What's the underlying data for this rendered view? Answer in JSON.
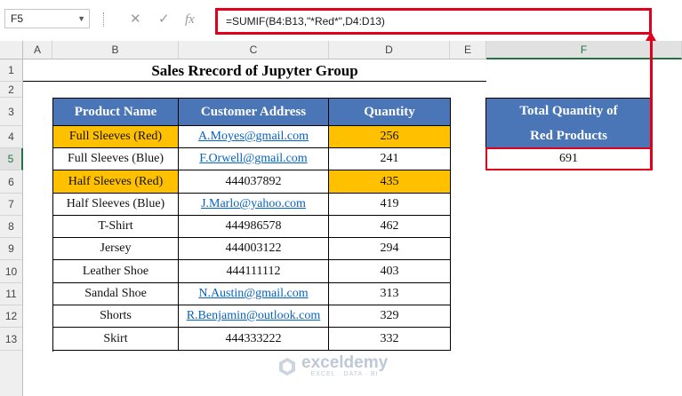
{
  "formula_bar": {
    "name_box": "F5",
    "formula": "=SUMIF(B4:B13,\"*Red*\",D4:D13)"
  },
  "columns": [
    "A",
    "B",
    "C",
    "D",
    "E",
    "F"
  ],
  "rows": [
    "1",
    "2",
    "3",
    "4",
    "5",
    "6",
    "7",
    "8",
    "9",
    "10",
    "11",
    "12",
    "13"
  ],
  "title": "Sales Rrecord of Jupyter Group",
  "table": {
    "headers": [
      "Product Name",
      "Customer Address",
      "Quantity"
    ],
    "rows": [
      {
        "product": "Full Sleeves (Red)",
        "address": "A.Moyes@gmail.com",
        "qty": "256"
      },
      {
        "product": "Full Sleeves (Blue)",
        "address": "F.Orwell@gmail.com",
        "qty": "241"
      },
      {
        "product": "Half Sleeves (Red)",
        "address": "444037892",
        "qty": "435"
      },
      {
        "product": "Half Sleeves (Blue)",
        "address": "J.Marlo@yahoo.com",
        "qty": "419"
      },
      {
        "product": "T-Shirt",
        "address": "444986578",
        "qty": "462"
      },
      {
        "product": "Jersey",
        "address": "444003122",
        "qty": "294"
      },
      {
        "product": "Leather Shoe",
        "address": "444111112",
        "qty": "403"
      },
      {
        "product": "Sandal Shoe",
        "address": "N.Austin@gmail.com",
        "qty": "313"
      },
      {
        "product": "Shorts",
        "address": "R.Benjamin@outlook.com",
        "qty": "329"
      },
      {
        "product": "Skirt",
        "address": "444333222",
        "qty": "332"
      }
    ]
  },
  "result": {
    "header_line1": "Total Quantity of",
    "header_line2": "Red Products",
    "value": "691"
  },
  "watermark": {
    "name": "exceldemy",
    "tagline": "EXCEL · DATA · BI"
  },
  "colors": {
    "header_bg": "#4a76b7",
    "highlight": "#ffc000",
    "annotation": "#e0001b",
    "link": "#0563c1"
  }
}
